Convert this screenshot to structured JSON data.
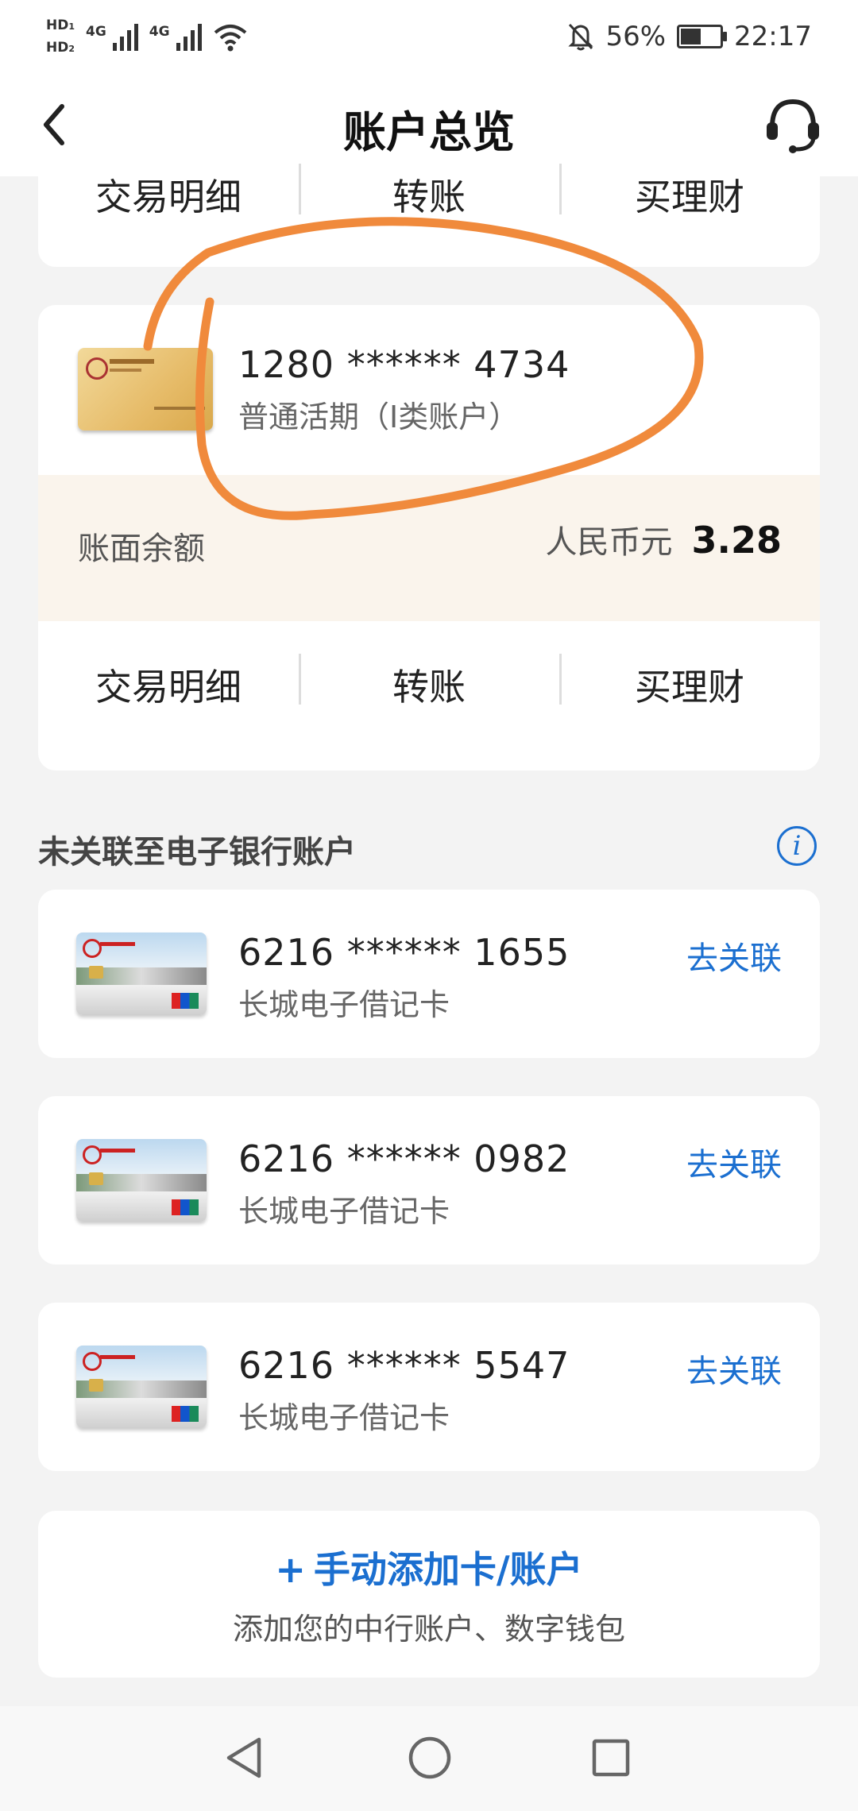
{
  "status_bar": {
    "hd1": "HD",
    "hd1_sub": "1",
    "hd2": "HD",
    "hd2_sub": "2",
    "network1": "4G",
    "network2": "4G",
    "battery_text": "56%",
    "battery_level": 0.56,
    "time": "22:17"
  },
  "header": {
    "title": "账户总览"
  },
  "top_card_actions": [
    "交易明细",
    "转账",
    "买理财"
  ],
  "main_account": {
    "number": "1280 ****** 4734",
    "type": "普通活期（I类账户）",
    "balance_label": "账面余额",
    "currency": "人民币元",
    "balance": "3.28",
    "actions": [
      "交易明细",
      "转账",
      "买理财"
    ]
  },
  "unlinked": {
    "title": "未关联至电子银行账户",
    "cards": [
      {
        "number": "6216 ****** 1655",
        "type": "长城电子借记卡",
        "action": "去关联"
      },
      {
        "number": "6216 ****** 0982",
        "type": "长城电子借记卡",
        "action": "去关联"
      },
      {
        "number": "6216 ****** 5547",
        "type": "长城电子借记卡",
        "action": "去关联"
      }
    ]
  },
  "add_account": {
    "icon": "+",
    "title": "手动添加卡/账户",
    "subtitle": "添加您的中行账户、数字钱包"
  },
  "colors": {
    "accent_blue": "#1b6fd0",
    "annotation_orange": "#f08a3c",
    "balance_bg": "#faf4ec"
  }
}
